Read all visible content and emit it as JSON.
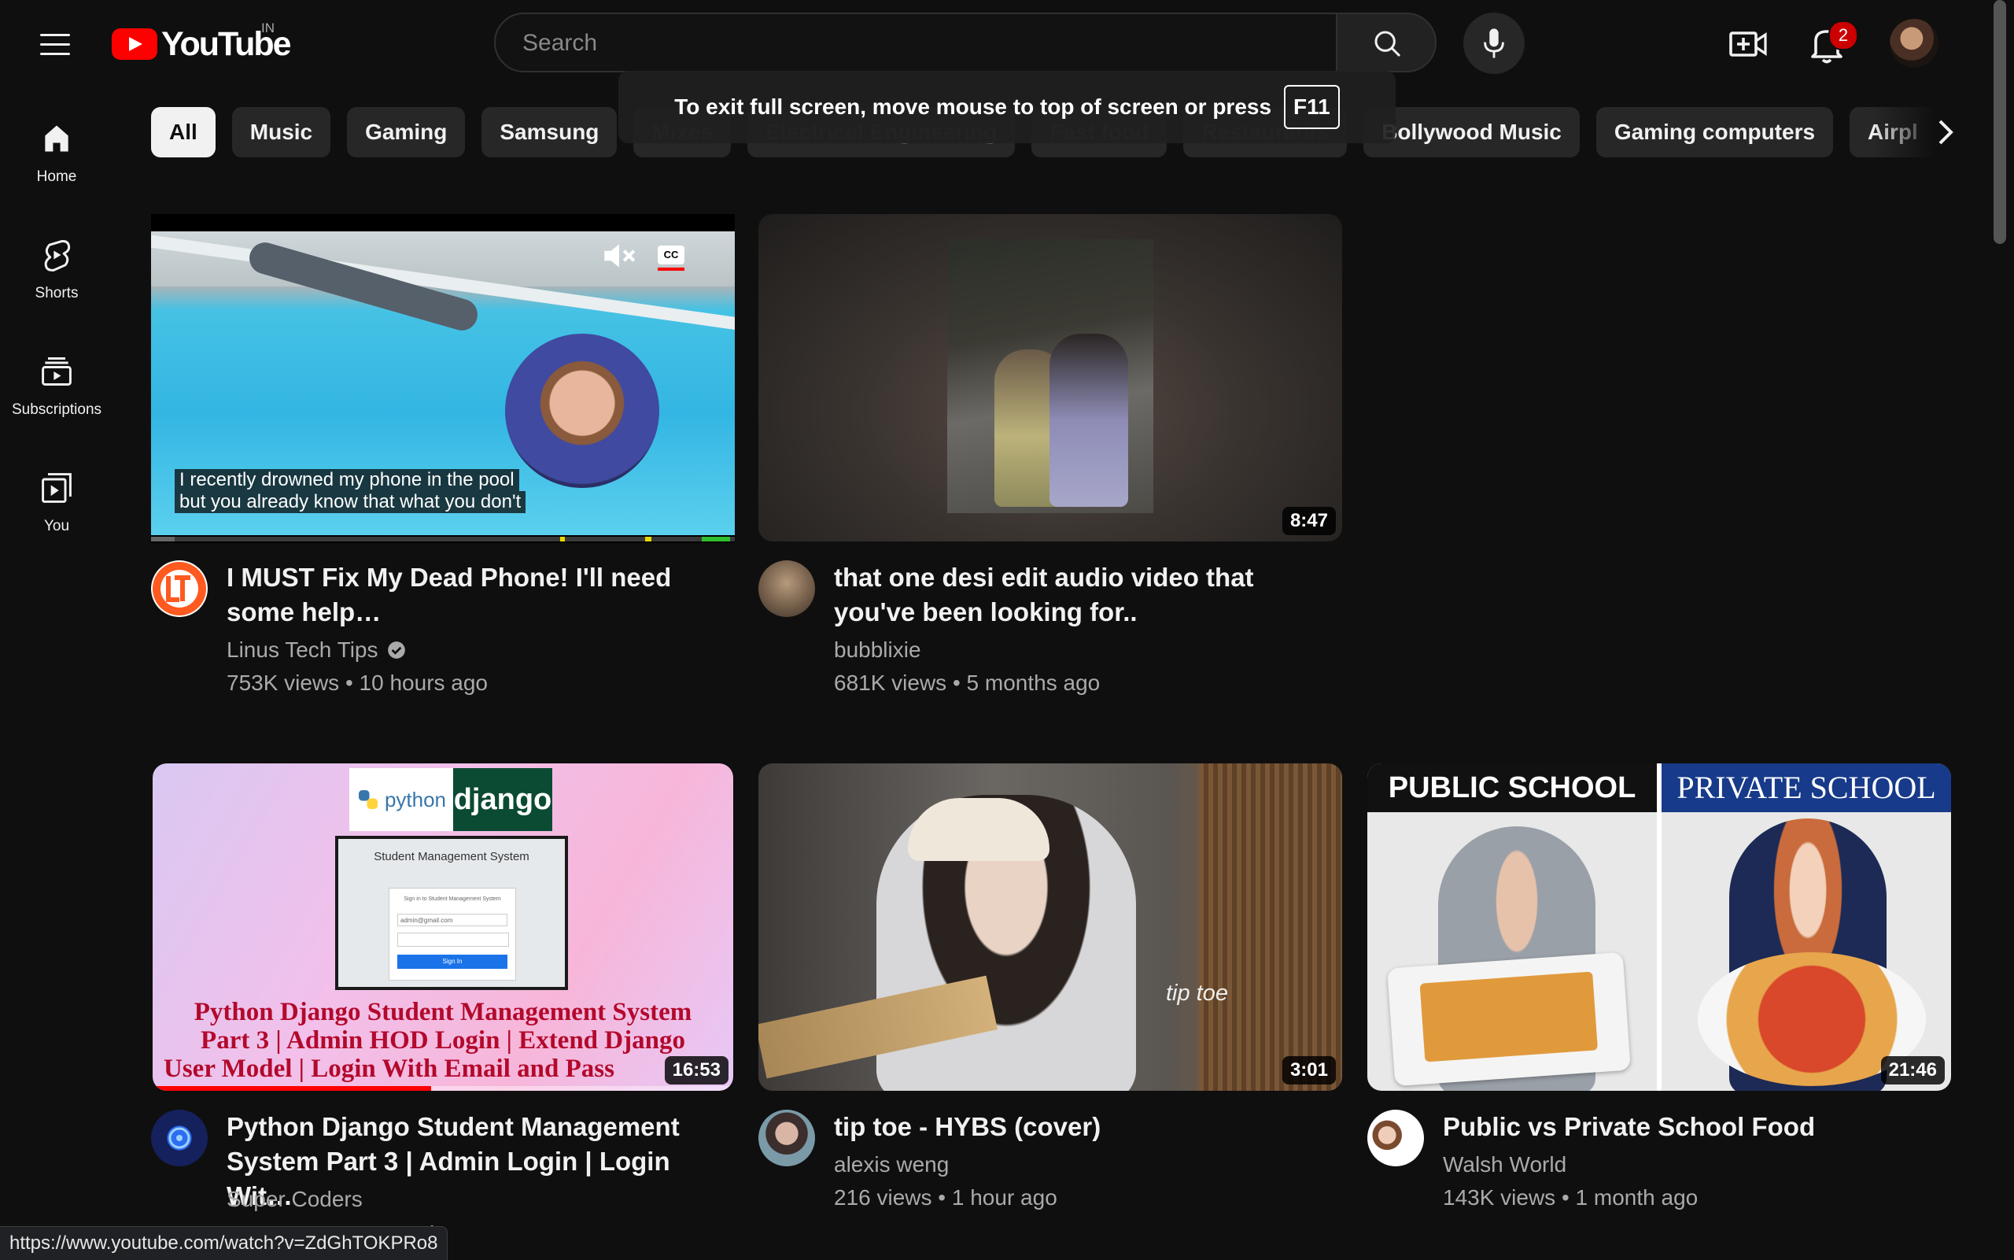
{
  "header": {
    "logo_text": "YouTube",
    "region": "IN",
    "search_placeholder": "Search",
    "notification_count": "2"
  },
  "fullscreen_notice": {
    "message": "To exit full screen, move mouse to top of screen or press",
    "key": "F11"
  },
  "guide": {
    "items": [
      {
        "label": "Home",
        "icon": "home-icon"
      },
      {
        "label": "Shorts",
        "icon": "shorts-icon"
      },
      {
        "label": "Subscriptions",
        "icon": "subscriptions-icon"
      },
      {
        "label": "You",
        "icon": "you-icon"
      }
    ]
  },
  "chips": [
    "All",
    "Music",
    "Gaming",
    "Samsung",
    "Mixes",
    "Electrical Engineering",
    "Fast food",
    "Restaurants",
    "Bollywood Music",
    "Gaming computers",
    "Airpl"
  ],
  "videos": [
    {
      "title": "I MUST Fix My Dead Phone! I'll need some help…",
      "channel": "Linus Tech Tips",
      "verified": true,
      "meta": "753K views • 10 hours ago",
      "captions": [
        "I recently drowned my phone in the pool",
        "but you already know that what you don't"
      ],
      "playing": true
    },
    {
      "title": "that one desi edit audio video that you've been looking for..",
      "channel": "bubblixie",
      "meta": "681K views • 5 months ago",
      "duration": "8:47"
    },
    {
      "title": "Python Django Student Management System Part 3 | Admin Login | Login Wit…",
      "channel": "Super Coders",
      "meta": "",
      "duration": "16:53",
      "progress": 0.48,
      "thumb_text": {
        "python": "python",
        "django": "django",
        "panel_title": "Student Management System",
        "panel_sub": "Sign in to Student Management System",
        "email": "admin@gmail.com",
        "signin": "Sign In",
        "headline": [
          "Python Django Student Management System",
          "Part 3 | Admin HOD Login | Extend Django",
          "User Model | Login With Email and Pass"
        ]
      }
    },
    {
      "title": "tip toe - HYBS (cover)",
      "channel": "alexis weng",
      "meta": "216 views • 1 hour ago",
      "duration": "3:01",
      "thumb_text": "tip toe"
    },
    {
      "title": "Public vs Private School Food",
      "channel": "Walsh World",
      "meta": "143K views • 1 month ago",
      "duration": "21:46",
      "thumb_text": {
        "left": "PUBLIC SCHOOL",
        "right": "PRIVATE SCHOOL"
      }
    }
  ],
  "status_bar": {
    "url": "https://www.youtube.com/watch?v=ZdGhTOKPRo8",
    "peek": "jo"
  },
  "colors": {
    "background": "#0f0f0f",
    "brand_red": "#ff0000",
    "text_secondary": "#aaaaaa",
    "chip_bg": "#272727"
  }
}
